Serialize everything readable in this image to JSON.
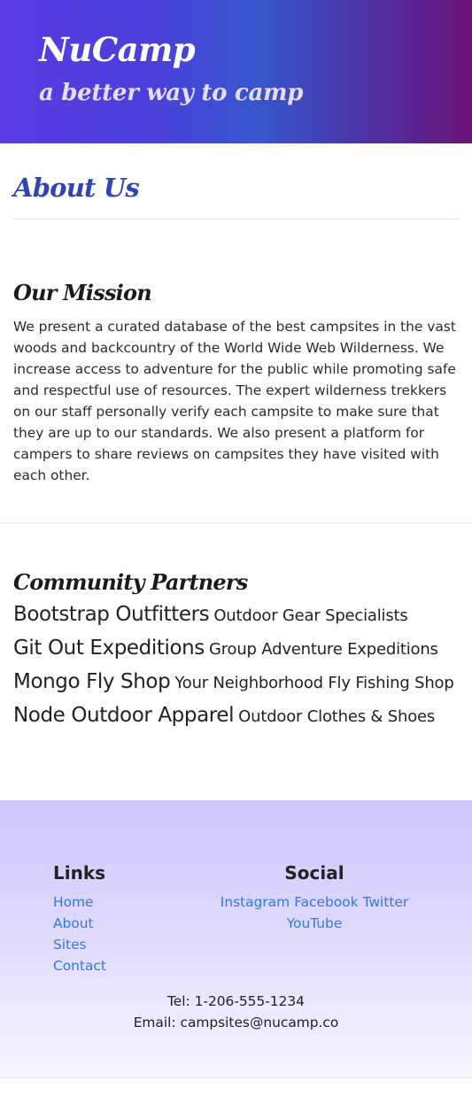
{
  "header": {
    "brand": "NuCamp",
    "tagline": "a better way to camp"
  },
  "about": {
    "title": "About Us"
  },
  "mission": {
    "heading": "Our Mission",
    "text": "We present a curated database of the best campsites in the vast woods and backcountry of the World Wide Web Wilderness. We increase access to adventure for the public while promoting safe and respectful use of resources. The expert wilderness trekkers on our staff personally verify each campsite to make sure that they are up to our standards. We also present a platform for campers to share reviews on campsites they have visited with each other."
  },
  "partners": {
    "heading": "Community Partners",
    "items": [
      {
        "name": "Bootstrap Outfitters",
        "description": "Outdoor Gear Specialists"
      },
      {
        "name": "Git Out Expeditions",
        "description": "Group Adventure Expeditions"
      },
      {
        "name": "Mongo Fly Shop",
        "description": "Your Neighborhood Fly Fishing Shop"
      },
      {
        "name": "Node Outdoor Apparel",
        "description": "Outdoor Clothes & Shoes"
      }
    ]
  },
  "footer": {
    "links_title": "Links",
    "links": [
      "Home",
      "About",
      "Sites",
      "Contact"
    ],
    "social_title": "Social",
    "social": [
      "Instagram",
      "Facebook",
      "Twitter",
      "YouTube"
    ],
    "tel": "Tel: 1-206-555-1234",
    "email": "Email: campsites@nucamp.co"
  },
  "colors": {
    "header_gradient_start": "#5a3be2",
    "header_gradient_end": "#6a1278",
    "about_title": "#2f45b5",
    "link": "#2f7ae5",
    "footer_top": "#cdc5fd"
  }
}
